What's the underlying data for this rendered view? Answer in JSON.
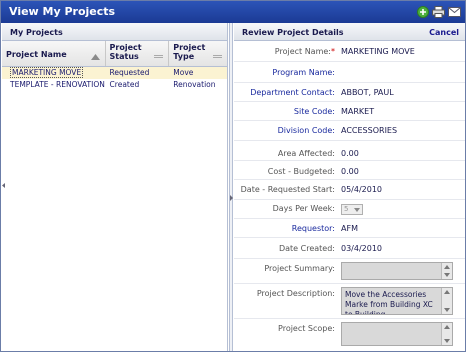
{
  "window": {
    "title": "View My Projects"
  },
  "toolbar": {
    "add_icon": "add-icon",
    "print_icon": "print-icon",
    "email_icon": "email-icon",
    "accent": "#2c54b8"
  },
  "left_panel": {
    "title": "My Projects",
    "columns": [
      "Project Name",
      "Project Status",
      "Project Type"
    ],
    "column_lines": [
      [
        "Project Name"
      ],
      [
        "Project",
        "Status"
      ],
      [
        "Project",
        "Type"
      ]
    ],
    "rows": [
      {
        "name": "MARKETING MOVE",
        "status": "Requested",
        "type": "Move",
        "selected": true
      },
      {
        "name": "TEMPLATE - RENOVATION",
        "status": "Created",
        "type": "Renovation",
        "selected": false
      }
    ]
  },
  "right_panel": {
    "title": "Review Project Details",
    "cancel_label": "Cancel",
    "fields": {
      "project_name": {
        "label": "Project Name:",
        "required_mark": "*",
        "value": "MARKETING MOVE"
      },
      "program_name": {
        "label": "Program Name:",
        "value": ""
      },
      "department_contact": {
        "label": "Department Contact:",
        "value": "ABBOT, PAUL"
      },
      "site_code": {
        "label": "Site Code:",
        "value": "MARKET"
      },
      "division_code": {
        "label": "Division Code:",
        "value": "ACCESSORIES"
      },
      "area_affected": {
        "label": "Area Affected:",
        "value": "0.00"
      },
      "cost_budgeted": {
        "label": "Cost - Budgeted:",
        "value": "0.00"
      },
      "date_requested_start": {
        "label": "Date - Requested Start:",
        "value": "05/4/2010"
      },
      "days_per_week": {
        "label": "Days Per Week:",
        "value": "5"
      },
      "requestor": {
        "label": "Requestor:",
        "value": "AFM"
      },
      "date_created": {
        "label": "Date Created:",
        "value": "03/4/2010"
      },
      "project_summary": {
        "label": "Project Summary:",
        "value": ""
      },
      "project_description": {
        "label": "Project Description:",
        "value": "Move the Accessories Marke from Building XC to Building"
      },
      "project_scope": {
        "label": "Project Scope:",
        "value": ""
      }
    }
  }
}
